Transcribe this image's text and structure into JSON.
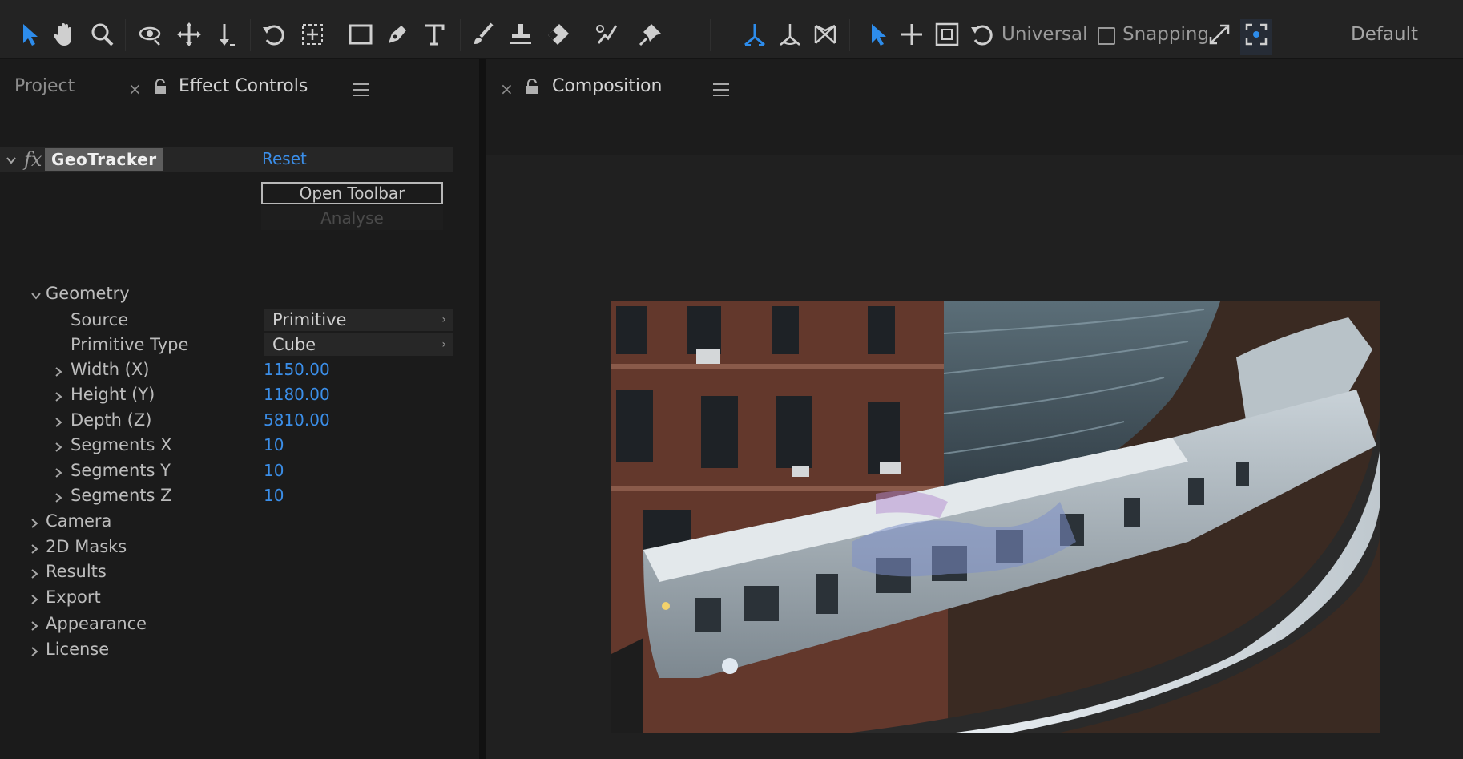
{
  "toolbar": {
    "tools": [
      "selection-tool",
      "hand-tool",
      "zoom-tool",
      "orbit-tool",
      "pan-tool",
      "dolly-tool",
      "rotate-tool",
      "pan-behind-tool",
      "rectangle-tool",
      "pen-tool",
      "type-tool",
      "brush-tool",
      "clone-stamp-tool",
      "eraser-tool",
      "roto-brush-tool",
      "puppet-tool"
    ],
    "axis_mode": "Universal",
    "snapping_label": "Snapping",
    "snapping_checked": false,
    "workspace": "Default",
    "accent_color": "#2d8ceb"
  },
  "left_panel": {
    "tab_project": "Project",
    "tab_effect_controls": "Effect Controls",
    "close_glyph": "×"
  },
  "effect": {
    "fx_glyph": "fx",
    "name": "GeoTracker",
    "reset_label": "Reset",
    "open_toolbar_label": "Open Toolbar",
    "analyse_label": "Analyse",
    "geometry": {
      "label": "Geometry",
      "source_label": "Source",
      "source_value": "Primitive",
      "primitive_type_label": "Primitive Type",
      "primitive_type_value": "Cube",
      "props": [
        {
          "label": "Width (X)",
          "value": "1150.00"
        },
        {
          "label": "Height (Y)",
          "value": "1180.00"
        },
        {
          "label": "Depth (Z)",
          "value": "5810.00"
        },
        {
          "label": "Segments X",
          "value": "10"
        },
        {
          "label": "Segments Y",
          "value": "10"
        },
        {
          "label": "Segments Z",
          "value": "10"
        }
      ]
    },
    "groups": [
      "Camera",
      "2D Masks",
      "Results",
      "Export",
      "Appearance",
      "License"
    ]
  },
  "composition": {
    "tab_label": "Composition",
    "close_glyph": "×"
  }
}
